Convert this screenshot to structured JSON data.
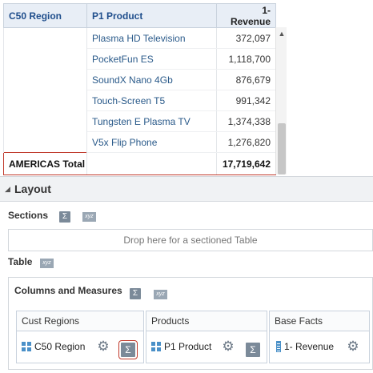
{
  "table": {
    "headers": {
      "region": "C50 Region",
      "product": "P1 Product",
      "revenue": "1- Revenue"
    },
    "rows": [
      {
        "product": "Plasma HD Television",
        "revenue": "372,097"
      },
      {
        "product": "PocketFun ES",
        "revenue": "1,118,700"
      },
      {
        "product": "SoundX Nano 4Gb",
        "revenue": "876,679"
      },
      {
        "product": "Touch-Screen T5",
        "revenue": "991,342"
      },
      {
        "product": "Tungsten E Plasma TV",
        "revenue": "1,374,338"
      },
      {
        "product": "V5x Flip Phone",
        "revenue": "1,276,820"
      }
    ],
    "total": {
      "label": "AMERICAS Total",
      "revenue": "17,719,642"
    }
  },
  "layout": {
    "title": "Layout",
    "sections_label": "Sections",
    "dropzone_text": "Drop here for a sectioned Table",
    "table_label": "Table",
    "columns_measures_label": "Columns and Measures",
    "sum_glyph": "Σ",
    "xyz_glyph": "xyz",
    "gear_glyph": "⚙",
    "columns": [
      {
        "header": "Cust Regions",
        "item": "C50 Region",
        "icon": "grid-icon"
      },
      {
        "header": "Products",
        "item": "P1 Product",
        "icon": "grid-icon"
      },
      {
        "header": "Base Facts",
        "item": "1- Revenue",
        "icon": "ruler-icon"
      }
    ]
  },
  "colors": {
    "accent_text": "#2a5a8a",
    "highlight_border": "#c0392b"
  }
}
